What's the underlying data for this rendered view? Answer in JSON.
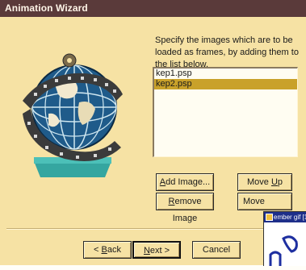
{
  "window": {
    "title": "Animation Wizard"
  },
  "instructions": "Specify the images which are to be loaded as frames, by adding them to the list below.",
  "frames_list": [
    {
      "name": "kep1.psp",
      "selected": false
    },
    {
      "name": "kep2.psp",
      "selected": true
    }
  ],
  "buttons": {
    "add_image": {
      "label": "Add Image...",
      "mnemonic": "A",
      "rest": "dd Image..."
    },
    "remove_image": {
      "label": "Remove Image",
      "mnemonic": "R",
      "rest": "emove Image"
    },
    "move_up": {
      "label": "Move Up",
      "prefix": "Move ",
      "mnemonic": "U",
      "rest": "p"
    },
    "move_down": {
      "label": "Move"
    },
    "back": {
      "label": "< Back",
      "prefix": "< ",
      "mnemonic": "B",
      "rest": "ack"
    },
    "next": {
      "label": "Next >",
      "mnemonic": "N",
      "rest": "ext >"
    },
    "cancel": {
      "label": "Cancel"
    }
  },
  "overlay_window": {
    "title": "ember gif [1"
  },
  "colors": {
    "dialog_bg": "#f6e2a4",
    "titlebar": "#5a3a3a",
    "selection": "#c9a12a",
    "overlay_titlebar": "#1e2f8a"
  },
  "icons": [
    "globe-film-icon",
    "paint-shop-pro-icon"
  ]
}
